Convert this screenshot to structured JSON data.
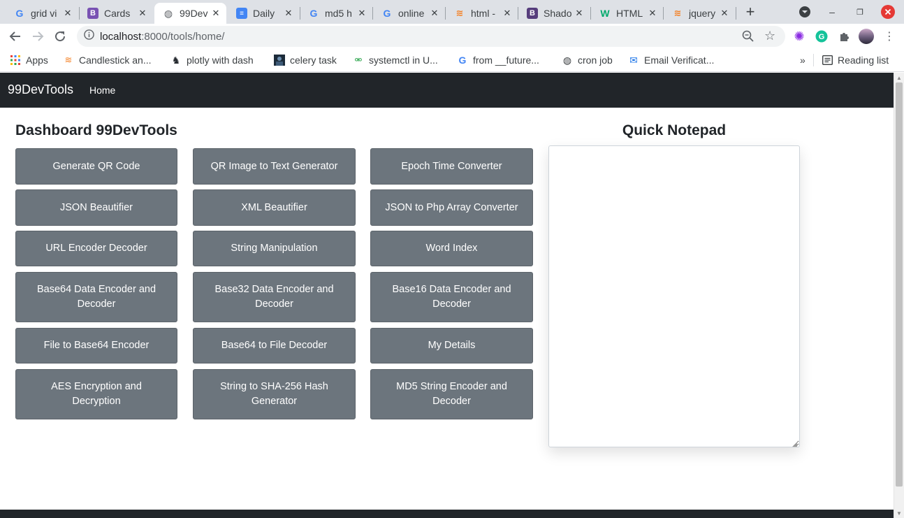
{
  "browser": {
    "tabs": [
      {
        "title": "grid vi",
        "icon": "google-icon"
      },
      {
        "title": "Cards",
        "icon": "bootstrap-icon"
      },
      {
        "title": "99Dev",
        "icon": "globe-icon"
      },
      {
        "title": "Daily",
        "icon": "docs-icon"
      },
      {
        "title": "md5 h",
        "icon": "google-icon"
      },
      {
        "title": "online",
        "icon": "google-icon"
      },
      {
        "title": "html -",
        "icon": "stackoverflow-icon"
      },
      {
        "title": "Shado",
        "icon": "bootstrap-icon"
      },
      {
        "title": "HTML",
        "icon": "w3schools-icon"
      },
      {
        "title": "jquery",
        "icon": "stackoverflow-icon"
      }
    ],
    "url_host": "localhost",
    "url_path": ":8000/tools/home/",
    "bookmarks": [
      {
        "label": "Apps",
        "icon": "apps-grid-icon"
      },
      {
        "label": "Candlestick an...",
        "icon": "stackoverflow-icon"
      },
      {
        "label": "plotly with dash",
        "icon": "github-icon"
      },
      {
        "label": "celery task",
        "icon": "image-icon"
      },
      {
        "label": "systemctl in U...",
        "icon": "ubuntu-icon"
      },
      {
        "label": "from __future...",
        "icon": "google-icon"
      },
      {
        "label": "cron job",
        "icon": "globe-icon"
      },
      {
        "label": "Email Verificat...",
        "icon": "mail-icon"
      }
    ],
    "more_bookmarks": "»",
    "reading_list": "Reading list"
  },
  "navbar": {
    "brand": "99DevTools",
    "home": "Home"
  },
  "dashboard": {
    "title": "Dashboard 99DevTools",
    "tools": [
      "Generate QR Code",
      "QR Image to Text Generator",
      "Epoch Time Converter",
      "JSON Beautifier",
      "XML Beautifier",
      "JSON to Php Array Converter",
      "URL Encoder Decoder",
      "String Manipulation",
      "Word Index",
      "Base64 Data Encoder and Decoder",
      "Base32 Data Encoder and Decoder",
      "Base16 Data Encoder and Decoder",
      "File to Base64 Encoder",
      "Base64 to File Decoder",
      "My Details",
      "AES Encryption and Decryption",
      "String to SHA-256 Hash Generator",
      "MD5 String Encoder and Decoder"
    ]
  },
  "notepad": {
    "title": "Quick Notepad",
    "value": ""
  },
  "colors": {
    "navbar": "#212529",
    "button": "#6c757d"
  }
}
